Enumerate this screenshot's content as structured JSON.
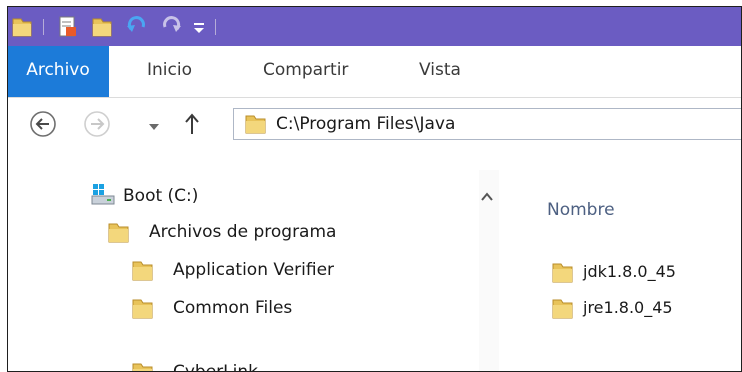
{
  "ribbon": {
    "tabs": [
      {
        "label": "Archivo",
        "active": true
      },
      {
        "label": "Inicio",
        "active": false
      },
      {
        "label": "Compartir",
        "active": false
      },
      {
        "label": "Vista",
        "active": false
      }
    ]
  },
  "address_bar": {
    "path": "C:\\Program Files\\Java"
  },
  "navigation_pane": {
    "items": [
      {
        "label": "Boot (C:)",
        "icon": "drive-icon"
      },
      {
        "label": "Archivos de programa",
        "icon": "folder-icon"
      },
      {
        "label": "Application Verifier",
        "icon": "folder-icon"
      },
      {
        "label": "Common Files",
        "icon": "folder-icon"
      },
      {
        "label": "CyberLink",
        "icon": "folder-icon"
      }
    ]
  },
  "file_list": {
    "column_header": "Nombre",
    "items": [
      {
        "name": "jdk1.8.0_45",
        "icon": "folder-icon"
      },
      {
        "name": "jre1.8.0_45",
        "icon": "folder-icon"
      }
    ]
  },
  "colors": {
    "titlebar": "#6b5cc2",
    "active_tab": "#1c7bd9",
    "folder": "#e8c35a"
  }
}
